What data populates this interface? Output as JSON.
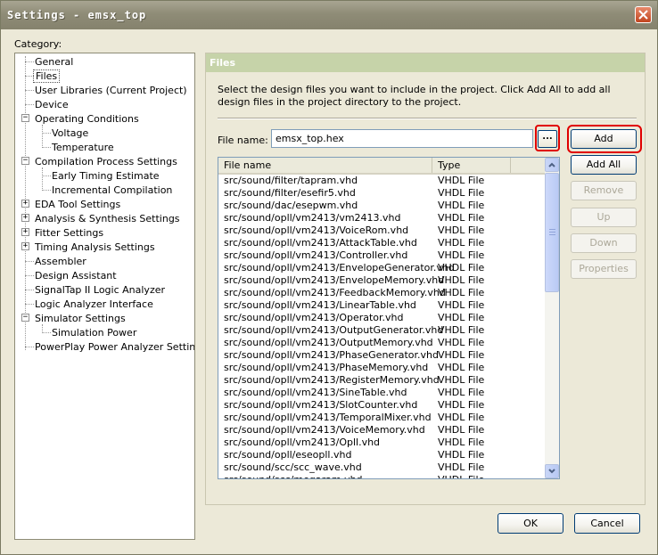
{
  "window": {
    "title": "Settings - emsx_top"
  },
  "category": {
    "label": "Category:",
    "items": [
      {
        "label": "General"
      },
      {
        "label": "Files"
      },
      {
        "label": "User Libraries (Current Project)"
      },
      {
        "label": "Device"
      },
      {
        "label": "Operating Conditions"
      },
      {
        "label": "Voltage"
      },
      {
        "label": "Temperature"
      },
      {
        "label": "Compilation Process Settings"
      },
      {
        "label": "Early Timing Estimate"
      },
      {
        "label": "Incremental Compilation"
      },
      {
        "label": "EDA Tool Settings"
      },
      {
        "label": "Analysis & Synthesis Settings"
      },
      {
        "label": "Fitter Settings"
      },
      {
        "label": "Timing Analysis Settings"
      },
      {
        "label": "Assembler"
      },
      {
        "label": "Design Assistant"
      },
      {
        "label": "SignalTap II Logic Analyzer"
      },
      {
        "label": "Logic Analyzer Interface"
      },
      {
        "label": "Simulator Settings"
      },
      {
        "label": "Simulation Power"
      },
      {
        "label": "PowerPlay Power Analyzer Settings"
      }
    ],
    "expander_collapse": "−",
    "expander_expand": "+"
  },
  "panel": {
    "title": "Files",
    "description": "Select the design files you want to include in the project. Click Add All to add all design files in the project directory to the project.",
    "file_name_label": "File name:",
    "file_name_value": "emsx_top.hex",
    "browse_label": "...",
    "buttons": {
      "add": "Add",
      "add_all": "Add All",
      "remove": "Remove",
      "up": "Up",
      "down": "Down",
      "properties": "Properties"
    },
    "columns": {
      "file_name": "File name",
      "type": "Type"
    },
    "files": [
      {
        "name": "src/sound/filter/tapram.vhd",
        "type": "VHDL File"
      },
      {
        "name": "src/sound/filter/esefir5.vhd",
        "type": "VHDL File"
      },
      {
        "name": "src/sound/dac/esepwm.vhd",
        "type": "VHDL File"
      },
      {
        "name": "src/sound/opll/vm2413/vm2413.vhd",
        "type": "VHDL File"
      },
      {
        "name": "src/sound/opll/vm2413/VoiceRom.vhd",
        "type": "VHDL File"
      },
      {
        "name": "src/sound/opll/vm2413/AttackTable.vhd",
        "type": "VHDL File"
      },
      {
        "name": "src/sound/opll/vm2413/Controller.vhd",
        "type": "VHDL File"
      },
      {
        "name": "src/sound/opll/vm2413/EnvelopeGenerator.vhd",
        "type": "VHDL File"
      },
      {
        "name": "src/sound/opll/vm2413/EnvelopeMemory.vhd",
        "type": "VHDL File"
      },
      {
        "name": "src/sound/opll/vm2413/FeedbackMemory.vhd",
        "type": "VHDL File"
      },
      {
        "name": "src/sound/opll/vm2413/LinearTable.vhd",
        "type": "VHDL File"
      },
      {
        "name": "src/sound/opll/vm2413/Operator.vhd",
        "type": "VHDL File"
      },
      {
        "name": "src/sound/opll/vm2413/OutputGenerator.vhd",
        "type": "VHDL File"
      },
      {
        "name": "src/sound/opll/vm2413/OutputMemory.vhd",
        "type": "VHDL File"
      },
      {
        "name": "src/sound/opll/vm2413/PhaseGenerator.vhd",
        "type": "VHDL File"
      },
      {
        "name": "src/sound/opll/vm2413/PhaseMemory.vhd",
        "type": "VHDL File"
      },
      {
        "name": "src/sound/opll/vm2413/RegisterMemory.vhd",
        "type": "VHDL File"
      },
      {
        "name": "src/sound/opll/vm2413/SineTable.vhd",
        "type": "VHDL File"
      },
      {
        "name": "src/sound/opll/vm2413/SlotCounter.vhd",
        "type": "VHDL File"
      },
      {
        "name": "src/sound/opll/vm2413/TemporalMixer.vhd",
        "type": "VHDL File"
      },
      {
        "name": "src/sound/opll/vm2413/VoiceMemory.vhd",
        "type": "VHDL File"
      },
      {
        "name": "src/sound/opll/vm2413/Opll.vhd",
        "type": "VHDL File"
      },
      {
        "name": "src/sound/opll/eseopll.vhd",
        "type": "VHDL File"
      },
      {
        "name": "src/sound/scc/scc_wave.vhd",
        "type": "VHDL File"
      },
      {
        "name": "src/sound/scc/megaram.vhd",
        "type": "VHDL File"
      }
    ]
  },
  "footer": {
    "ok": "OK",
    "cancel": "Cancel"
  },
  "colors": {
    "highlight_red": "#e00000",
    "panel_header": "#c6d3a9",
    "dialog_bg": "#ece9d8"
  }
}
